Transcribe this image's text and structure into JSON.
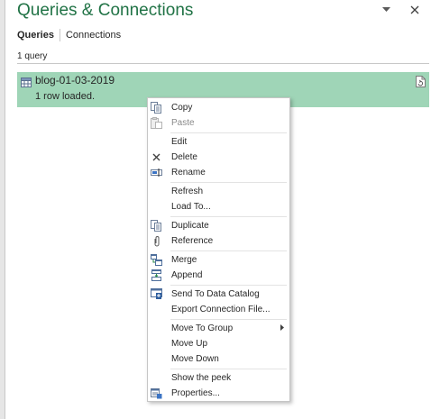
{
  "pane": {
    "title": "Queries & Connections",
    "tabs": [
      {
        "label": "Queries",
        "active": true
      },
      {
        "label": "Connections",
        "active": false
      }
    ],
    "query_count": "1 query",
    "accent_color": "#217346",
    "selection_color": "#9fd5b7"
  },
  "query": {
    "name": "blog-01-03-2019",
    "status": "1 row loaded."
  },
  "context_menu": {
    "items": [
      {
        "label": "Copy",
        "icon": "copy-icon",
        "enabled": true
      },
      {
        "label": "Paste",
        "icon": "paste-icon",
        "enabled": false
      },
      {
        "label": "Edit",
        "icon": "",
        "enabled": true
      },
      {
        "label": "Delete",
        "icon": "delete-icon",
        "enabled": true
      },
      {
        "label": "Rename",
        "icon": "rename-icon",
        "enabled": true
      },
      {
        "label": "Refresh",
        "icon": "",
        "enabled": true
      },
      {
        "label": "Load To...",
        "icon": "",
        "enabled": true
      },
      {
        "label": "Duplicate",
        "icon": "duplicate-icon",
        "enabled": true
      },
      {
        "label": "Reference",
        "icon": "reference-icon",
        "enabled": true
      },
      {
        "label": "Merge",
        "icon": "merge-icon",
        "enabled": true
      },
      {
        "label": "Append",
        "icon": "append-icon",
        "enabled": true
      },
      {
        "label": "Send To Data Catalog",
        "icon": "data-catalog-icon",
        "enabled": true
      },
      {
        "label": "Export Connection File...",
        "icon": "",
        "enabled": true
      },
      {
        "label": "Move To Group",
        "icon": "",
        "enabled": true,
        "submenu": true
      },
      {
        "label": "Move Up",
        "icon": "",
        "enabled": true
      },
      {
        "label": "Move Down",
        "icon": "",
        "enabled": true
      },
      {
        "label": "Show the peek",
        "icon": "",
        "enabled": true
      },
      {
        "label": "Properties...",
        "icon": "properties-icon",
        "enabled": true
      }
    ]
  }
}
